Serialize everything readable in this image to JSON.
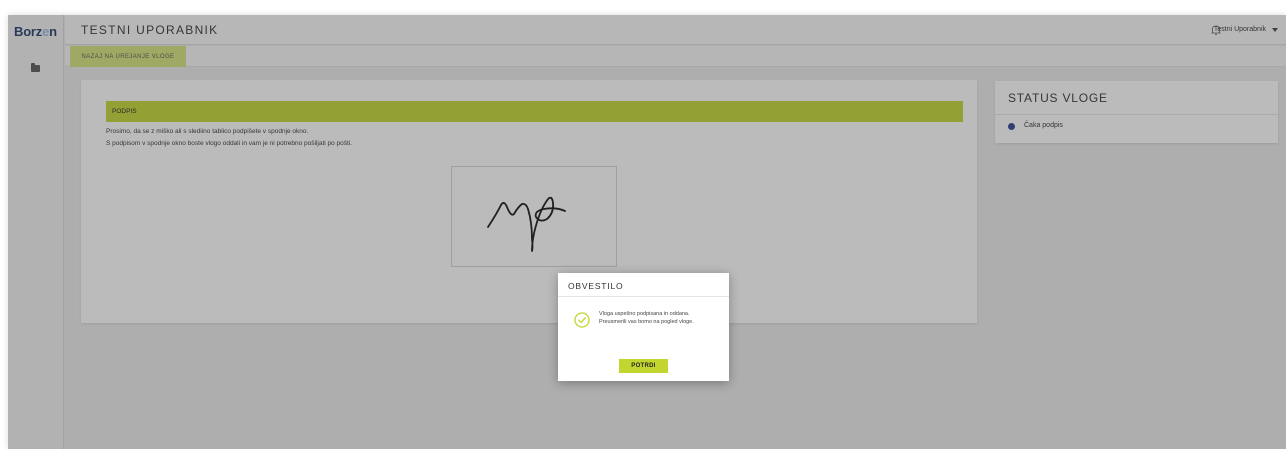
{
  "app": {
    "logo_main": "Borz",
    "logo_mid": "e",
    "logo_end": "n"
  },
  "header": {
    "title": "TESTNI UPORABNIK",
    "user_name": "Testni Uporabnik"
  },
  "subnav": {
    "back_label": "NAZAJ NA UREJANJE VLOGE"
  },
  "signature": {
    "section_title": "PODPIS",
    "instruction_1": "Prosimo, da se z miško ali s slediino tablico podpišete v spodnje okno.",
    "instruction_2": "S podpisom v spodnje okno boste vlogo oddali in vam je ni potrebno pošiljati po pošti."
  },
  "status": {
    "title": "STATUS VLOGE",
    "value": "Čaka podpis",
    "dot_color": "#2b3f8e"
  },
  "modal": {
    "title": "OBVESTILO",
    "message": "Vloga uspešno podpisana in oddana. Preusmerili vas bomo na pogled vloge.",
    "confirm_label": "POTRDI"
  },
  "colors": {
    "accent": "#c2d62f",
    "accent_light": "#d6e37a",
    "brand": "#1c3a6e"
  },
  "icons": [
    "folder-icon",
    "bell-icon",
    "chevron-down-icon",
    "check-circle-icon"
  ]
}
